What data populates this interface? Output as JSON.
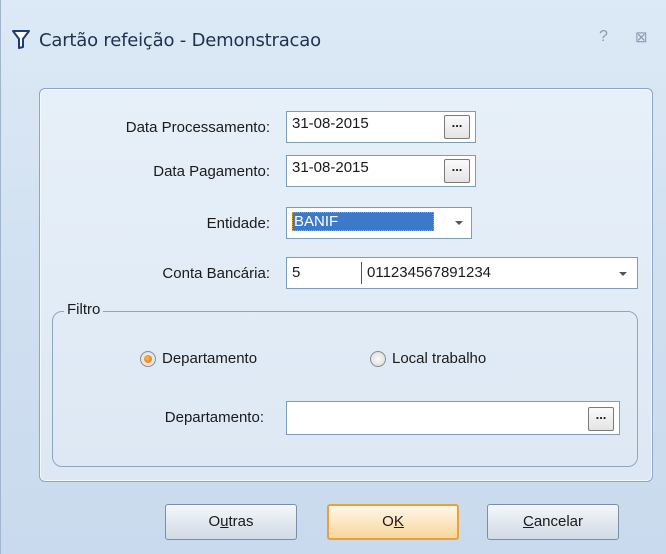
{
  "window": {
    "title": "Cartão refeição - Demonstracao",
    "help_label": "?",
    "close_label": "⊠"
  },
  "form": {
    "data_processamento": {
      "label": "Data Processamento:",
      "value": "31-08-2015",
      "button_label": "..."
    },
    "data_pagamento": {
      "label": "Data Pagamento:",
      "value": "31-08-2015",
      "button_label": "..."
    },
    "entidade": {
      "label": "Entidade:",
      "value": "BANIF"
    },
    "conta_bancaria": {
      "label": "Conta Bancária:",
      "code": "5",
      "account": "011234567891234"
    }
  },
  "filtro": {
    "title": "Filtro",
    "radio_departamento": "Departamento",
    "radio_local": "Local trabalho",
    "selected": "Departamento",
    "departamento_label": "Departamento:",
    "departamento_value": "",
    "button_label": "..."
  },
  "buttons": {
    "outras_pre": "O",
    "outras_u": "u",
    "outras_post": "tras",
    "ok_pre": "O",
    "ok_u": "K",
    "cancelar_u": "C",
    "cancelar_post": "ancelar"
  },
  "colors": {
    "accent": "#e06a00",
    "selection": "#3c79c8",
    "window_bg": "#cfdff0"
  },
  "icons": {
    "app": "filter-icon",
    "help": "help-icon",
    "close": "close-icon"
  }
}
